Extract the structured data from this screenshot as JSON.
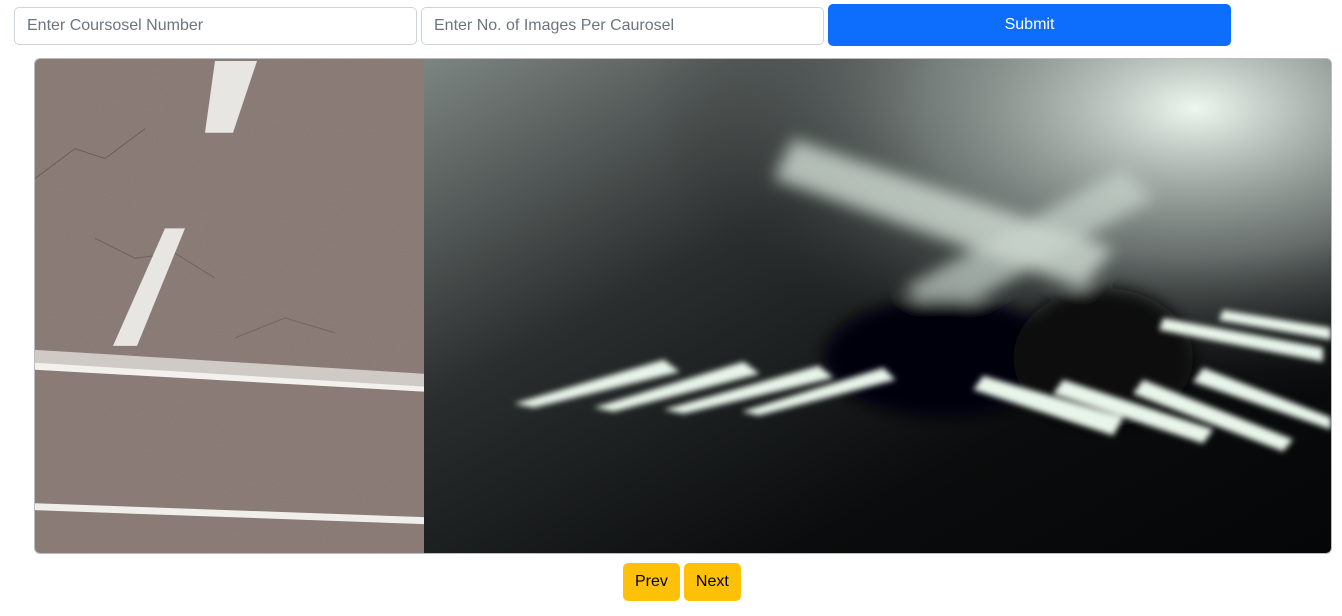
{
  "form": {
    "carousel_number_placeholder": "Enter Coursosel Number",
    "carousel_number_value": "",
    "images_per_carousel_placeholder": "Enter No. of Images Per Caurosel",
    "images_per_carousel_value": "",
    "submit_label": "Submit"
  },
  "carousel": {
    "slides": [
      {
        "image": "asphalt-road-with-lane-markings"
      },
      {
        "image": "blurred-forks-on-dark-table"
      }
    ]
  },
  "controls": {
    "prev_label": "Prev",
    "next_label": "Next"
  },
  "colors": {
    "primary": "#0d6efd",
    "warning": "#ffc107"
  }
}
